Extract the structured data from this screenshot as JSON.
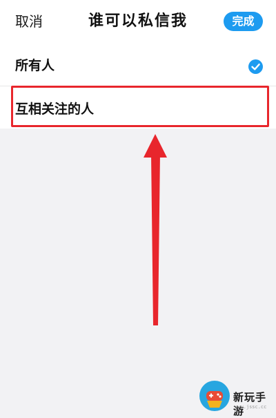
{
  "header": {
    "cancel_label": "取消",
    "title": "谁可以私信我",
    "done_label": "完成"
  },
  "options": [
    {
      "label": "所有人",
      "selected": true
    },
    {
      "label": "互相关注的人",
      "selected": false
    }
  ],
  "colors": {
    "accent": "#1d9bf0",
    "annotation": "#e8262c",
    "background": "#f2f2f4"
  },
  "watermark": {
    "text": "新玩手游",
    "url": "www.jssc.cc"
  }
}
